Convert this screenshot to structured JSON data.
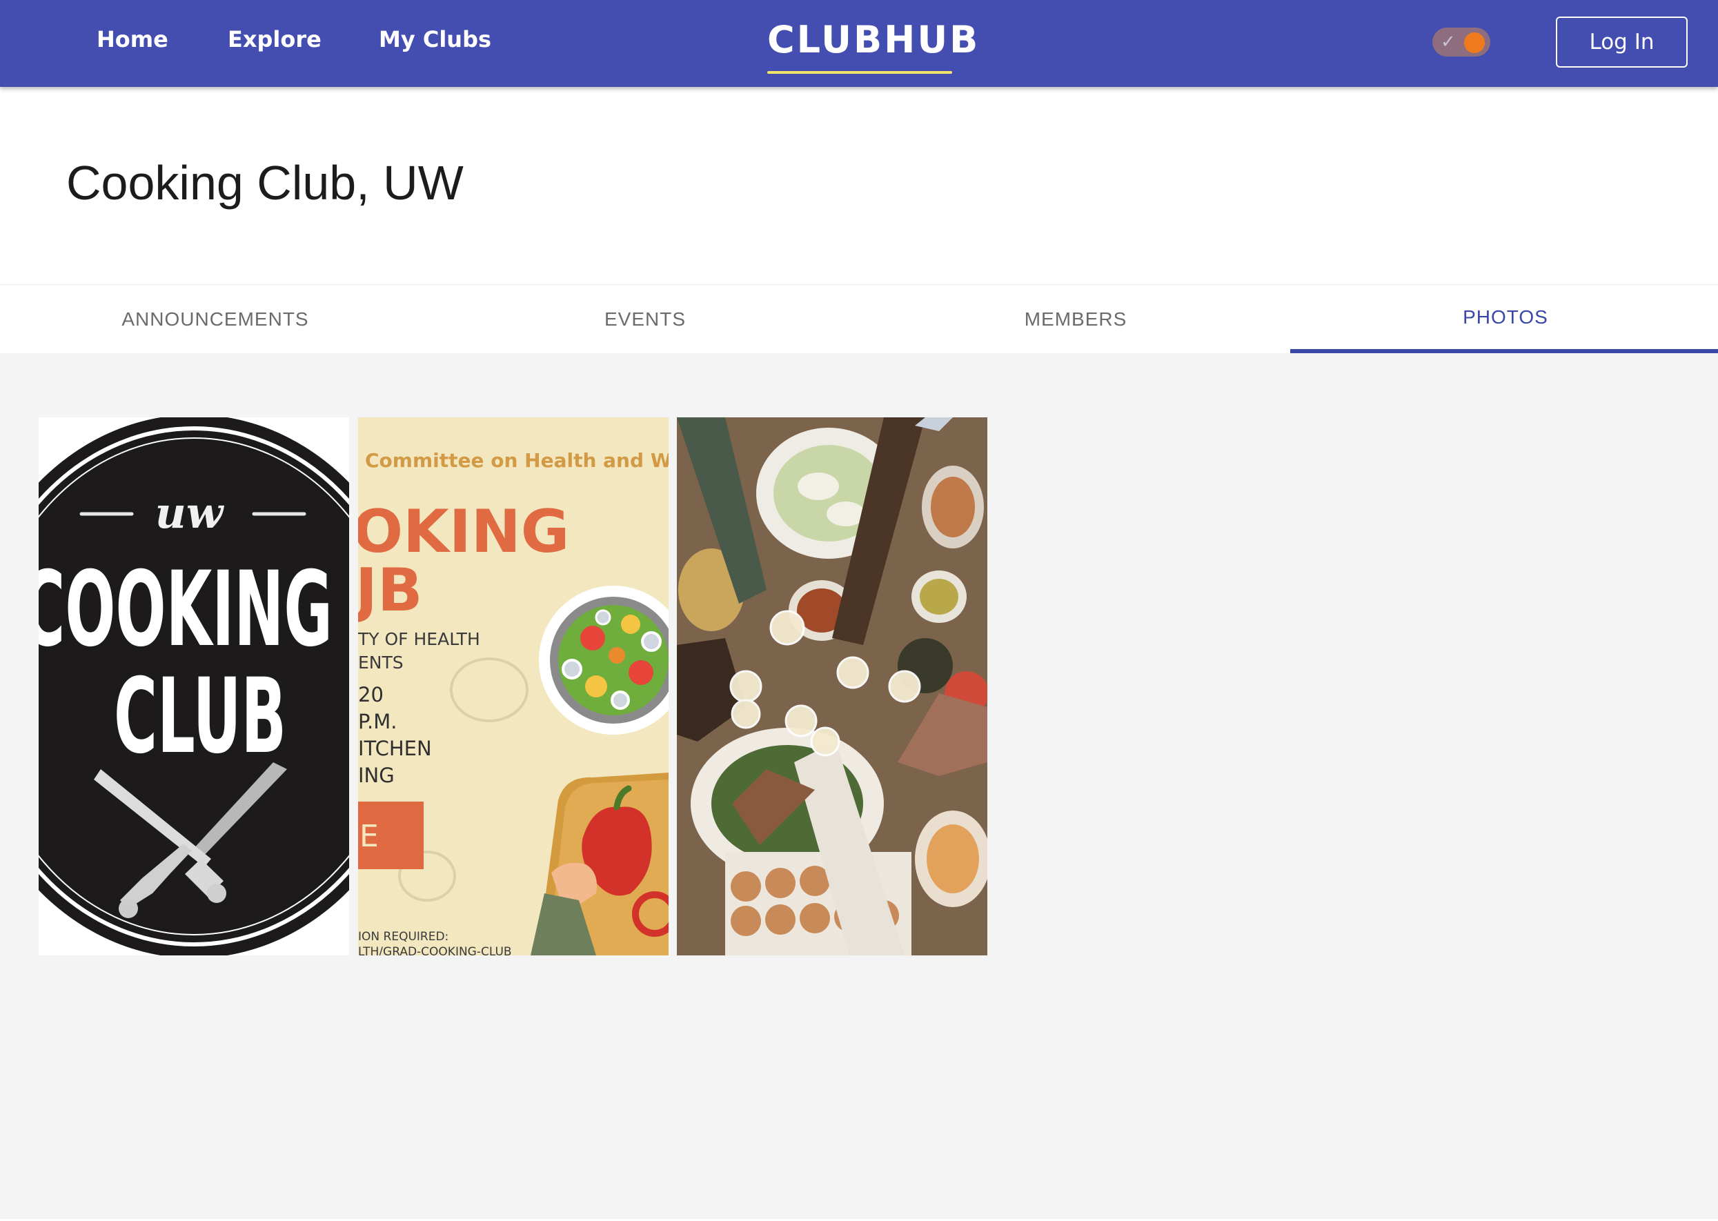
{
  "nav": {
    "home": "Home",
    "explore": "Explore",
    "my_clubs": "My Clubs",
    "brand": "CLUBHUB",
    "login": "Log In",
    "toggle_state": "on"
  },
  "club": {
    "title": "Cooking Club, UW"
  },
  "tabs": [
    {
      "label": "ANNOUNCEMENTS",
      "active": false
    },
    {
      "label": "EVENTS",
      "active": false
    },
    {
      "label": "MEMBERS",
      "active": false
    },
    {
      "label": "PHOTOS",
      "active": true
    }
  ],
  "photos": [
    {
      "kind": "logo",
      "script": "uw",
      "line1": "COOKING",
      "line2": "CLUB"
    },
    {
      "kind": "flyer",
      "committee": "Committee on Health and Well-",
      "headline1": "OKING",
      "headline2": "JB",
      "details": [
        "TY  OF  HEALTH",
        "ENTS",
        "20",
        "P.M.",
        "ITCHEN",
        "ING"
      ],
      "button": "E",
      "footer1": "ION REQUIRED:",
      "footer2": "LTH/GRAD-COOKING-CLUB"
    },
    {
      "kind": "dinner-toast-photo"
    }
  ],
  "colors": {
    "nav_bg": "#434eb0",
    "accent": "#3a46a8",
    "brand_underline": "#f2e36a",
    "toggle_knob": "#f07a1e",
    "flyer_orange": "#e06a42"
  }
}
